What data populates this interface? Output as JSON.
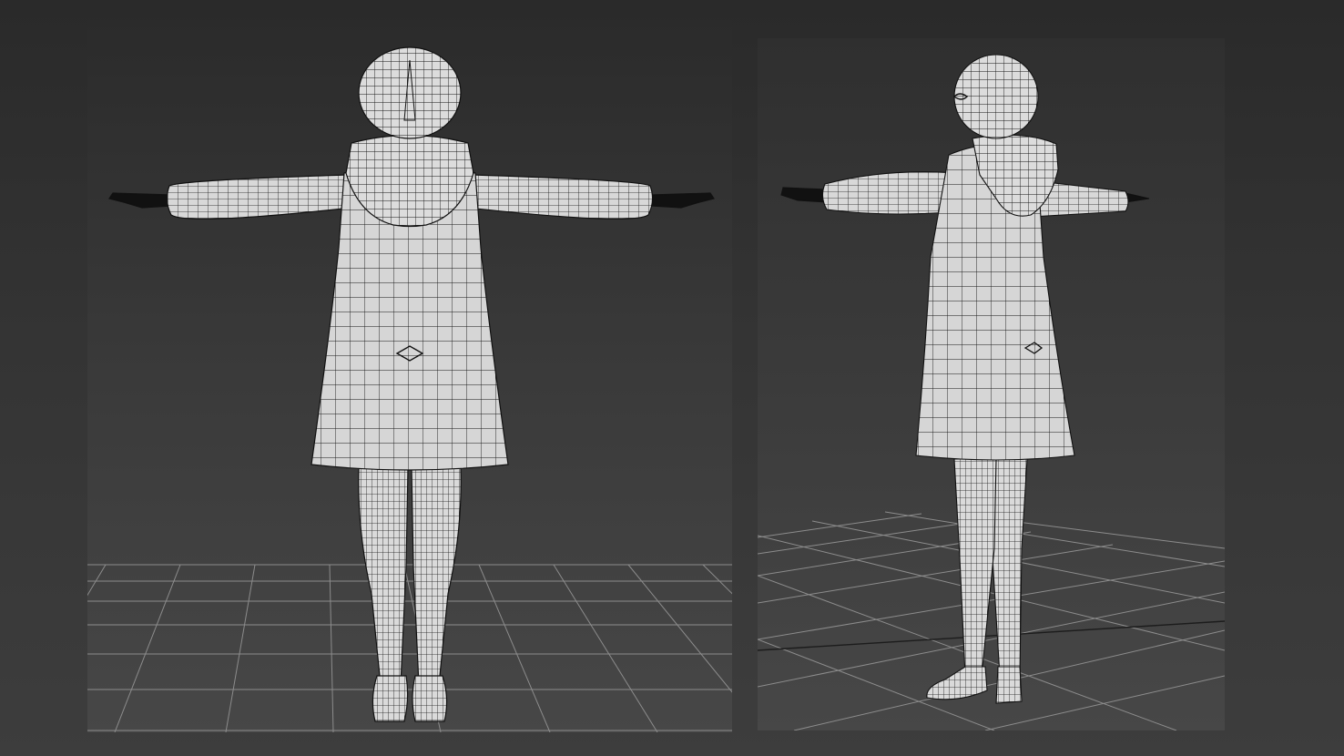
{
  "app": {
    "canvas_bg": "#333333",
    "viewport_bg": "#3a3a3a"
  },
  "viewports": [
    {
      "name": "front-view",
      "grid_color": "#8a8a8a",
      "mesh_fill": "#d9d9d9",
      "wire_color": "#1a1a1a"
    },
    {
      "name": "perspective-view",
      "grid_color": "#8a8a8a",
      "mesh_fill": "#d9d9d9",
      "wire_color": "#1a1a1a"
    }
  ]
}
